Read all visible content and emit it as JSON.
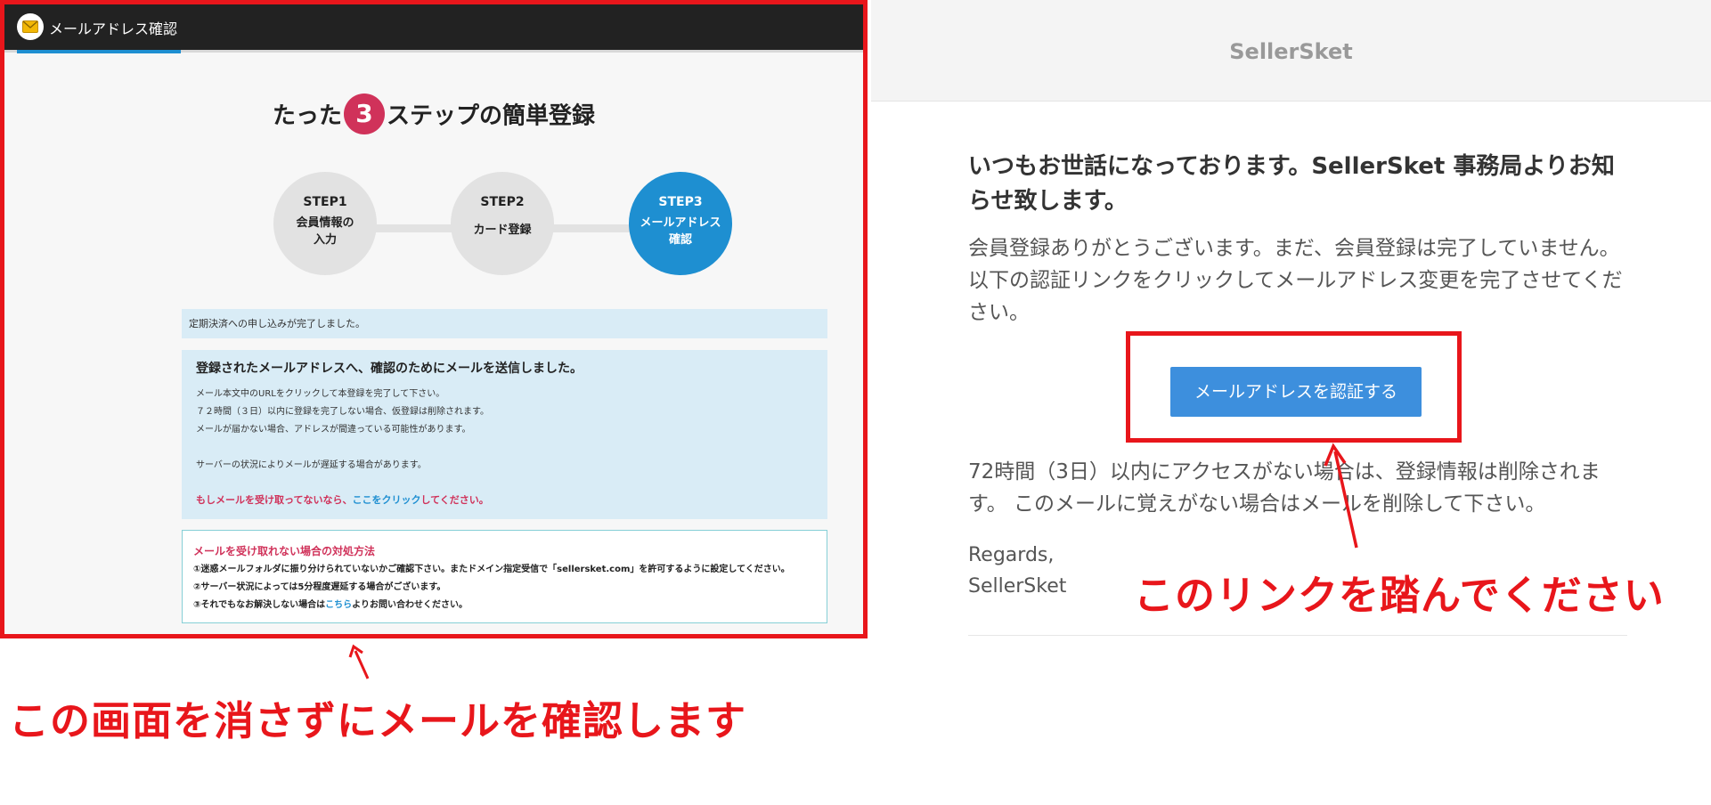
{
  "site": {
    "topbar": {
      "title": "メールアドレス確認",
      "icon": "envelope-icon"
    },
    "heading": {
      "before": "たった",
      "number": "3",
      "after": "ステップの簡単登録"
    },
    "steps": [
      {
        "title": "STEP1",
        "label": "会員情報の\n入力",
        "active": false
      },
      {
        "title": "STEP2",
        "label": "カード登録",
        "active": false
      },
      {
        "title": "STEP3",
        "label": "メールアドレス\n確認",
        "active": true
      }
    ],
    "notice": "定期決済への申し込みが完了しました。",
    "info": {
      "title": "登録されたメールアドレスへ、確認のためにメールを送信しました。",
      "lines": [
        "メール本文中のURLをクリックして本登録を完了して下さい。",
        "７２時間（３日）以内に登録を完了しない場合、仮登録は削除されます。",
        "メールが届かない場合、アドレスが間違っている可能性があります。",
        "サーバーの状況によりメールが遅延する場合があります。"
      ],
      "resend_before": "もしメールを受け取ってないなら、",
      "resend_link": "ここをクリック",
      "resend_after": "してください。"
    },
    "help": {
      "title": "メールを受け取れない場合の対処方法",
      "line1": "①迷惑メールフォルダに振り分けられていないかご確認下さい。またドメイン指定受信で「sellersket.com」を許可するように設定してください。",
      "line2": "②サーバー状況によっては5分程度遅延する場合がございます。",
      "line3_before": "③それでもなお解決しない場合は",
      "line3_link": "こちら",
      "line3_after": "よりお問い合わせください。"
    }
  },
  "email": {
    "brand": "SellerSket",
    "heading": "いつもお世話になっております。SellerSket 事務局よりお知らせ致します。",
    "body": "会員登録ありがとうございます。まだ、会員登録は完了していません。 以下の認証リンクをクリックしてメールアドレス変更を完了させてください。",
    "button_label": "メールアドレスを認証する",
    "note": "72時間（3日）以内にアクセスがない場合は、登録情報は削除されます。 このメールに覚えがない場合はメールを削除して下さい。",
    "regards": "Regards,",
    "signature": "SellerSket"
  },
  "annotations": {
    "left_caption": "この画面を消さずにメールを確認します",
    "right_caption": "このリンクを踏んでください",
    "color": "#e8161b"
  },
  "colors": {
    "accent_blue": "#1e8fd1",
    "accent_pink": "#d0325a",
    "button_blue": "#3d8fdd"
  }
}
